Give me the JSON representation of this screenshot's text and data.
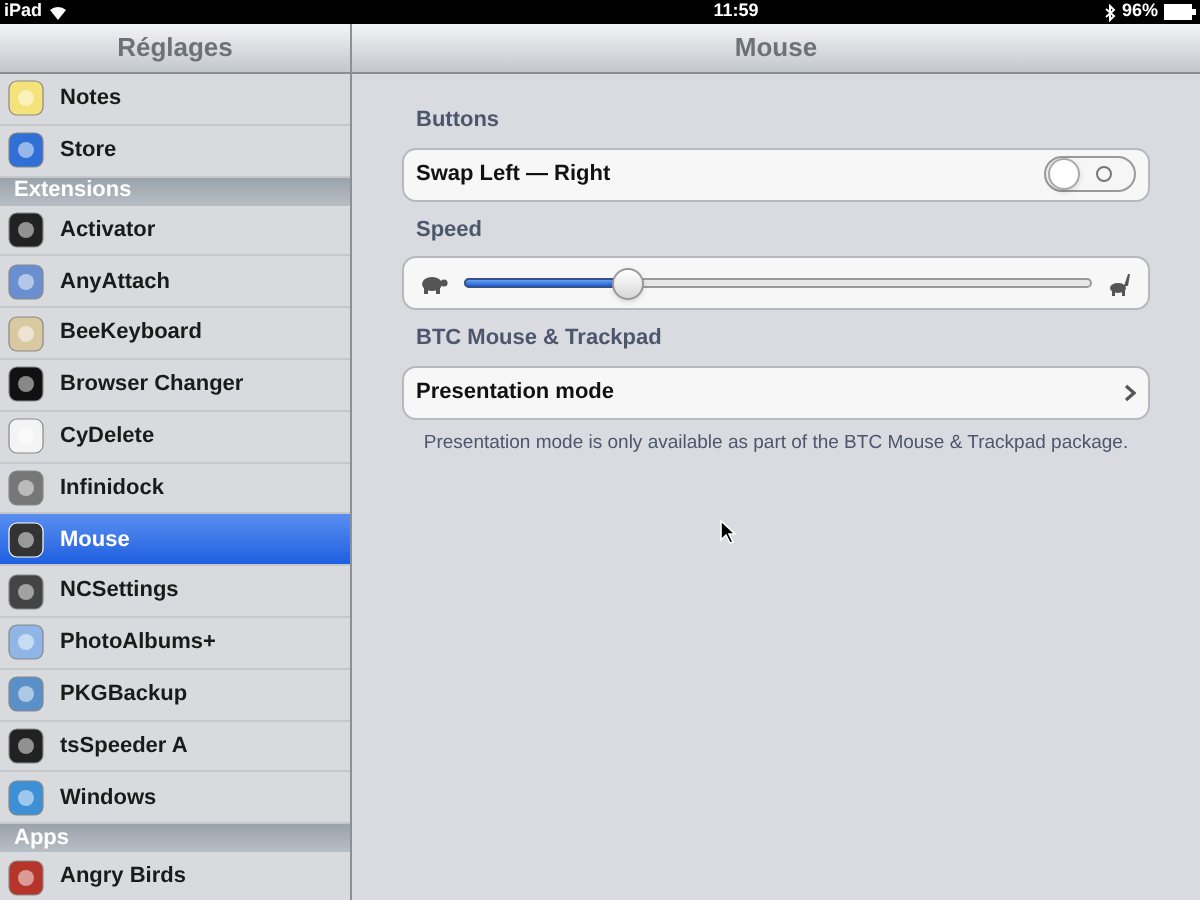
{
  "status_bar": {
    "device": "iPad",
    "time": "11:59",
    "battery": "96%"
  },
  "sidebar": {
    "title": "Réglages",
    "items": [
      {
        "kind": "item",
        "label": "Notes",
        "selected": false
      },
      {
        "kind": "item",
        "label": "Store",
        "selected": false
      },
      {
        "kind": "header",
        "label": "Extensions"
      },
      {
        "kind": "item",
        "label": "Activator",
        "selected": false
      },
      {
        "kind": "item",
        "label": "AnyAttach",
        "selected": false
      },
      {
        "kind": "item",
        "label": "BeeKeyboard",
        "selected": false
      },
      {
        "kind": "item",
        "label": "Browser Changer",
        "selected": false
      },
      {
        "kind": "item",
        "label": "CyDelete",
        "selected": false
      },
      {
        "kind": "item",
        "label": "Infinidock",
        "selected": false
      },
      {
        "kind": "item",
        "label": "Mouse",
        "selected": true
      },
      {
        "kind": "item",
        "label": "NCSettings",
        "selected": false
      },
      {
        "kind": "item",
        "label": "PhotoAlbums+",
        "selected": false
      },
      {
        "kind": "item",
        "label": "PKGBackup",
        "selected": false
      },
      {
        "kind": "item",
        "label": "tsSpeeder A",
        "selected": false
      },
      {
        "kind": "item",
        "label": "Windows",
        "selected": false
      },
      {
        "kind": "header",
        "label": "Apps"
      },
      {
        "kind": "item",
        "label": "Angry Birds",
        "selected": false
      }
    ]
  },
  "detail": {
    "title": "Mouse",
    "groups": [
      {
        "heading": "Buttons",
        "rows": [
          {
            "kind": "switch",
            "label": "Swap Left — Right",
            "on": false
          }
        ]
      },
      {
        "heading": "Speed",
        "rows": [
          {
            "kind": "slider",
            "level": 0.26
          }
        ]
      },
      {
        "heading": "BTC Mouse & Trackpad",
        "rows": [
          {
            "kind": "link",
            "label": "Presentation mode"
          }
        ],
        "footer": "Presentation mode is only available as part of the BTC Mouse & Trackpad package."
      }
    ]
  }
}
